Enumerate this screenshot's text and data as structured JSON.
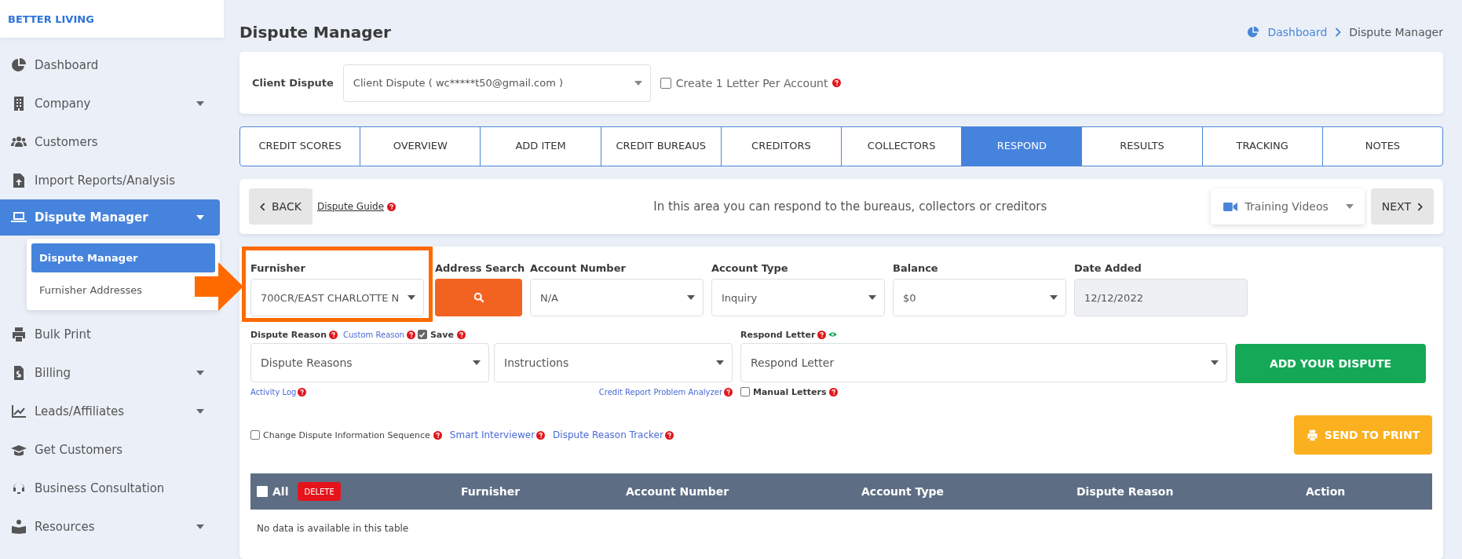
{
  "brand": "BETTER LIVING",
  "sidebar": {
    "items": [
      {
        "label": "Dashboard",
        "selected": false,
        "dropdown": false
      },
      {
        "label": "Company",
        "selected": false,
        "dropdown": true
      },
      {
        "label": "Customers",
        "selected": false,
        "dropdown": false
      },
      {
        "label": "Import Reports/Analysis",
        "selected": false,
        "dropdown": false
      },
      {
        "label": "Dispute Manager",
        "selected": true,
        "dropdown": true,
        "children": [
          {
            "label": "Dispute Manager",
            "selected": true
          },
          {
            "label": "Furnisher Addresses",
            "selected": false
          }
        ]
      },
      {
        "label": "Bulk Print",
        "selected": false,
        "dropdown": false
      },
      {
        "label": "Billing",
        "selected": false,
        "dropdown": true
      },
      {
        "label": "Leads/Affiliates",
        "selected": false,
        "dropdown": true
      },
      {
        "label": "Get Customers",
        "selected": false,
        "dropdown": false
      },
      {
        "label": "Business Consultation",
        "selected": false,
        "dropdown": false
      },
      {
        "label": "Resources",
        "selected": false,
        "dropdown": true
      }
    ]
  },
  "page_title": "Dispute Manager",
  "breadcrumb": [
    {
      "label": "Dashboard",
      "kind": "link"
    },
    {
      "label": "Dispute Manager",
      "kind": "current"
    }
  ],
  "client_dispute": {
    "label": "Client Dispute",
    "value": "Client Dispute ( wc*****t50@gmail.com )",
    "option": {
      "label": "Create 1 Letter Per Account",
      "checked": false
    }
  },
  "tabs": [
    {
      "label": "CREDIT SCORES",
      "selected": false
    },
    {
      "label": "OVERVIEW",
      "selected": false
    },
    {
      "label": "ADD ITEM",
      "selected": false
    },
    {
      "label": "CREDIT BUREAUS",
      "selected": false
    },
    {
      "label": "CREDITORS",
      "selected": false
    },
    {
      "label": "COLLECTORS",
      "selected": false
    },
    {
      "label": "RESPOND",
      "selected": true
    },
    {
      "label": "RESULTS",
      "selected": false
    },
    {
      "label": "TRACKING",
      "selected": false
    },
    {
      "label": "NOTES",
      "selected": false
    }
  ],
  "action_bar": {
    "back": "BACK",
    "guide": "Dispute Guide",
    "info": "In this area you can respond to the bureaus, collectors or creditors",
    "videos": "Training Videos",
    "next": "NEXT"
  },
  "fields": [
    {
      "label": "Furnisher",
      "kind": "select",
      "value": "700CR/EAST CHARLOTTE N"
    },
    {
      "label": "Address Search",
      "kind": "search"
    },
    {
      "label": "Account Number",
      "kind": "select",
      "value": "N/A"
    },
    {
      "label": "Account Type",
      "kind": "select",
      "value": "Inquiry"
    },
    {
      "label": "Balance",
      "kind": "select",
      "value": "$0"
    },
    {
      "label": "Date Added",
      "kind": "readonly",
      "value": "12/12/2022"
    }
  ],
  "dispute": {
    "label": "Dispute Reason",
    "custom_link": "Custom Reason",
    "save": {
      "label": "Save",
      "checked": true
    },
    "reasons": "Dispute Reasons",
    "instructions": "Instructions",
    "activity_link": "Activity Log",
    "analyzer_link": "Credit Report Problem Analyzer",
    "letter_label": "Respond Letter",
    "letter": "Respond Letter",
    "manual": {
      "label": "Manual Letters",
      "checked": false
    },
    "add_button": "ADD YOUR DISPUTE"
  },
  "options": {
    "sequence": {
      "label": "Change Dispute Information Sequence",
      "checked": false
    },
    "links": [
      "Smart Interviewer",
      "Dispute Reason Tracker"
    ],
    "print_button": "SEND TO PRINT"
  },
  "table": {
    "select_all": {
      "label": "All",
      "checked": false
    },
    "delete": "DELETE",
    "columns": [
      "Furnisher",
      "Account Number",
      "Account Type",
      "Dispute Reason",
      "Action"
    ],
    "empty": "No data is available in this table"
  }
}
